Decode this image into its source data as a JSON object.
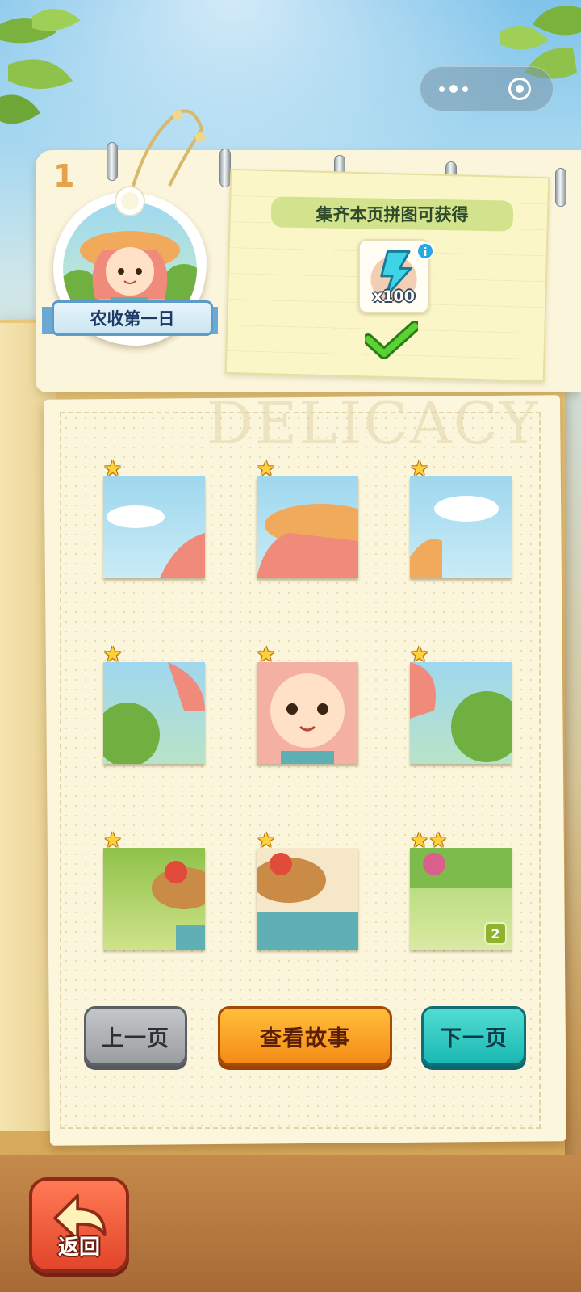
{
  "capsule": {
    "more_icon": "more-dots-icon",
    "close_icon": "target-ring-icon"
  },
  "page": {
    "number": "1",
    "watermark": "DELICACY"
  },
  "chapter_badge": {
    "title": "农收第一日"
  },
  "reward": {
    "title": "集齐本页拼图可获得",
    "item_icon": "lightning-energy-icon",
    "count": "x100",
    "info": "i",
    "status_icon": "green-check-icon"
  },
  "pieces": [
    {
      "stars": "★",
      "count": ""
    },
    {
      "stars": "★",
      "count": ""
    },
    {
      "stars": "★",
      "count": ""
    },
    {
      "stars": "★",
      "count": ""
    },
    {
      "stars": "★",
      "count": ""
    },
    {
      "stars": "★",
      "count": ""
    },
    {
      "stars": "★",
      "count": ""
    },
    {
      "stars": "★",
      "count": ""
    },
    {
      "stars": "★★",
      "count": "2"
    }
  ],
  "buttons": {
    "prev": "上一页",
    "story": "查看故事",
    "next": "下一页"
  },
  "back": {
    "label": "返回",
    "icon": "back-arrow-icon"
  },
  "colors": {
    "star": "#ffd23a",
    "accent_orange": "#f58b16",
    "accent_teal": "#1ab8b3",
    "check_green": "#4cc22c"
  }
}
